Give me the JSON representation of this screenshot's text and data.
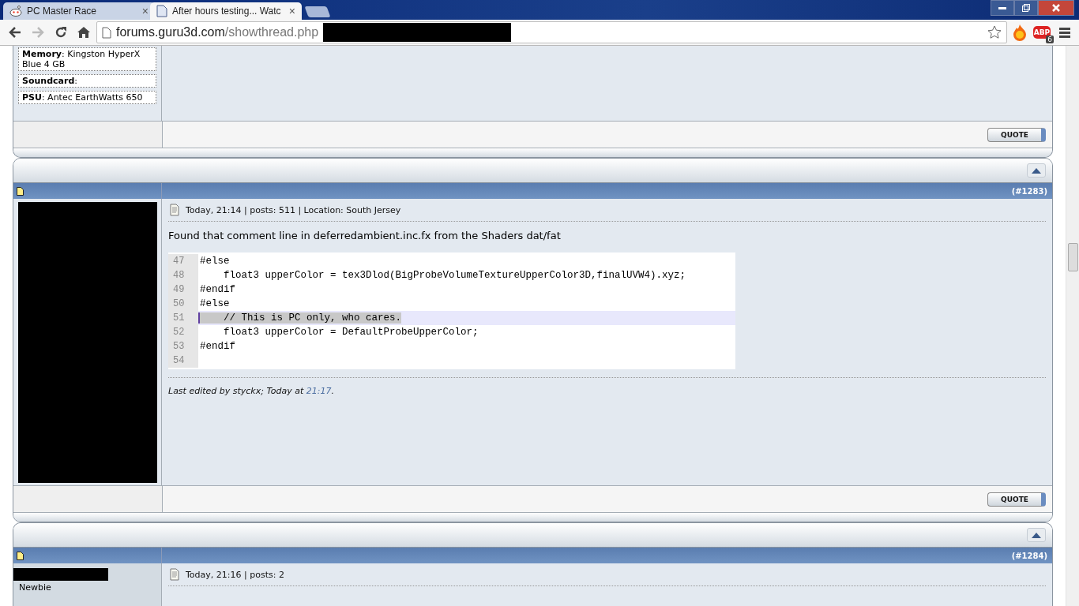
{
  "browser": {
    "tabs": [
      {
        "title": "PC Master Race",
        "kind": "alien",
        "selected": false
      },
      {
        "title": "After hours testing... Watc",
        "kind": "page",
        "selected": true
      }
    ],
    "close_glyph": "×",
    "url": {
      "host": "forums.guru3d.com",
      "path": "/showthread.php"
    },
    "extensions": [
      {
        "kind": "flame"
      },
      {
        "kind": "abp",
        "label": "ABP",
        "badge": "6"
      }
    ]
  },
  "previous_post": {
    "specs": [
      "**Memory**: Kingston HyperX Blue 4 GB",
      "**Soundcard**:",
      "**PSU**: Antec EarthWatts 650"
    ],
    "quote": "QUOTE"
  },
  "post": {
    "number": "(#1283)",
    "meta": "Today, 21:14 | posts: 511 | Location: South Jersey",
    "body": "Found that comment line in deferredambient.inc.fx from the Shaders dat/fat",
    "code": [
      {
        "num": "47",
        "text": "#else",
        "selected": false
      },
      {
        "num": "48",
        "text": "    float3 upperColor = tex3Dlod(BigProbeVolumeTextureUpperColor3D,finalUVW4).xyz;",
        "selected": false
      },
      {
        "num": "49",
        "text": "#endif",
        "selected": false
      },
      {
        "num": "50",
        "text": "#else",
        "selected": false
      },
      {
        "num": "51",
        "text": "    // This is PC only, who cares.",
        "selected": true
      },
      {
        "num": "52",
        "text": "    float3 upperColor = DefaultProbeUpperColor;",
        "selected": false
      },
      {
        "num": "53",
        "text": "#endif",
        "selected": false
      },
      {
        "num": "54",
        "selected": false
      }
    ],
    "edited": {
      "prefix": "Last edited by styckx; Today at ",
      "time": "21:17",
      "suffix": "."
    },
    "quote": "QUOTE"
  },
  "next_post": {
    "number": "(#1284)",
    "rank": "Newbie",
    "meta": "Today, 21:16 | posts: 2"
  }
}
